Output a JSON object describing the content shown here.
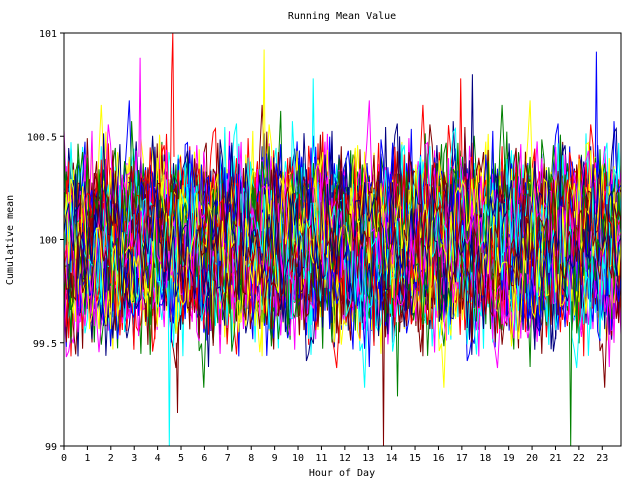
{
  "chart_data": {
    "type": "line",
    "title": "Running Mean Value",
    "xlabel": "Hour of Day",
    "ylabel": "Cumulative mean",
    "xlim": [
      0,
      23.8
    ],
    "ylim": [
      99,
      101
    ],
    "xticks": [
      "0",
      "1",
      "2",
      "3",
      "4",
      "5",
      "6",
      "7",
      "8",
      "9",
      "10",
      "11",
      "12",
      "13",
      "14",
      "15",
      "16",
      "17",
      "18",
      "19",
      "20",
      "21",
      "22",
      "23"
    ],
    "yticks": [
      "99",
      "99.5",
      "100",
      "100.5",
      "101"
    ],
    "grid": false,
    "legend": "none",
    "series_colors": [
      "#0000ff",
      "#ff0000",
      "#008000",
      "#ff00ff",
      "#00ffff",
      "#ffff00",
      "#000080",
      "#800000"
    ],
    "series_count": 80,
    "points_per_series": 240,
    "center": 100,
    "spread": 0.2,
    "series": [
      {
        "x": [
          4.55,
          4.6,
          4.65,
          4.7
        ],
        "y": [
          100.3,
          100.8,
          101.0,
          100.4
        ]
      },
      {
        "x": [
          4.45,
          4.5,
          4.55
        ],
        "y": [
          99.8,
          99.0,
          99.6
        ]
      },
      {
        "x": [
          13.6,
          13.65,
          13.7
        ],
        "y": [
          99.7,
          99.0,
          99.8
        ]
      },
      {
        "x": [
          21.6,
          21.65,
          21.7
        ],
        "y": [
          99.6,
          99.0,
          99.7
        ]
      },
      {
        "x": [
          8.5,
          8.55,
          8.6
        ],
        "y": [
          100.4,
          100.92,
          100.3
        ]
      },
      {
        "x": [
          22.7,
          22.75,
          22.8
        ],
        "y": [
          100.4,
          100.91,
          100.3
        ]
      },
      {
        "x": [
          3.2,
          3.25,
          3.3
        ],
        "y": [
          100.4,
          100.88,
          100.3
        ]
      },
      {
        "x": [
          17.4,
          17.45,
          17.5
        ],
        "y": [
          100.4,
          100.8,
          100.3
        ]
      },
      {
        "x": [
          16.9,
          16.95,
          17.0
        ],
        "y": [
          100.3,
          100.78,
          100.4
        ]
      },
      {
        "x": [
          10.6,
          10.65,
          10.7
        ],
        "y": [
          100.3,
          100.78,
          100.4
        ]
      },
      {
        "x": [
          4.8,
          4.85,
          4.9
        ],
        "y": [
          99.5,
          99.16,
          99.6
        ]
      },
      {
        "x": [
          14.2,
          14.25,
          14.3
        ],
        "y": [
          99.6,
          99.24,
          99.6
        ]
      }
    ]
  }
}
